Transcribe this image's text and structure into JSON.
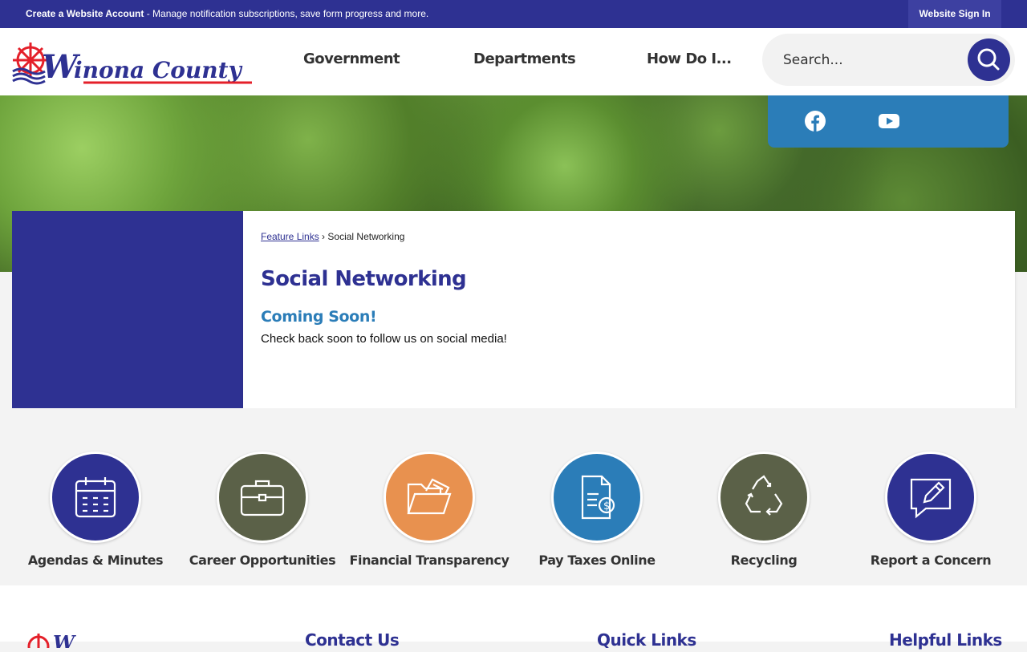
{
  "topbar": {
    "account_link": "Create a Website Account",
    "account_desc": " - Manage notification subscriptions, save form progress and more.",
    "signin": "Website Sign In"
  },
  "logo": {
    "text": "Winona County"
  },
  "nav": {
    "items": [
      "Government",
      "Departments",
      "How Do I..."
    ]
  },
  "search": {
    "placeholder": "Search..."
  },
  "social": {
    "icons": [
      "facebook-icon",
      "youtube-icon"
    ]
  },
  "breadcrumb": {
    "parent": "Feature Links",
    "separator": "›",
    "current": "Social Networking"
  },
  "page": {
    "title": "Social Networking",
    "subtitle": "Coming Soon!",
    "body": "Check back soon to follow us on social media!"
  },
  "quick_links": [
    {
      "label": "Agendas & Minutes",
      "icon": "calendar-icon",
      "color": "#2e3192"
    },
    {
      "label": "Career Opportunities",
      "icon": "briefcase-icon",
      "color": "#5b6148"
    },
    {
      "label": "Financial Transparency",
      "icon": "folder-icon",
      "color": "#e8914f"
    },
    {
      "label": "Pay Taxes Online",
      "icon": "bill-icon",
      "color": "#2b7db8"
    },
    {
      "label": "Recycling",
      "icon": "recycle-icon",
      "color": "#5b6148"
    },
    {
      "label": "Report a Concern",
      "icon": "report-icon",
      "color": "#2e3192"
    }
  ],
  "footer": {
    "columns": [
      "Contact Us",
      "Quick Links",
      "Helpful Links"
    ]
  },
  "colors": {
    "primary": "#2e3192",
    "accent": "#2b7db8",
    "orange": "#e8914f",
    "olive": "#5b6148"
  }
}
